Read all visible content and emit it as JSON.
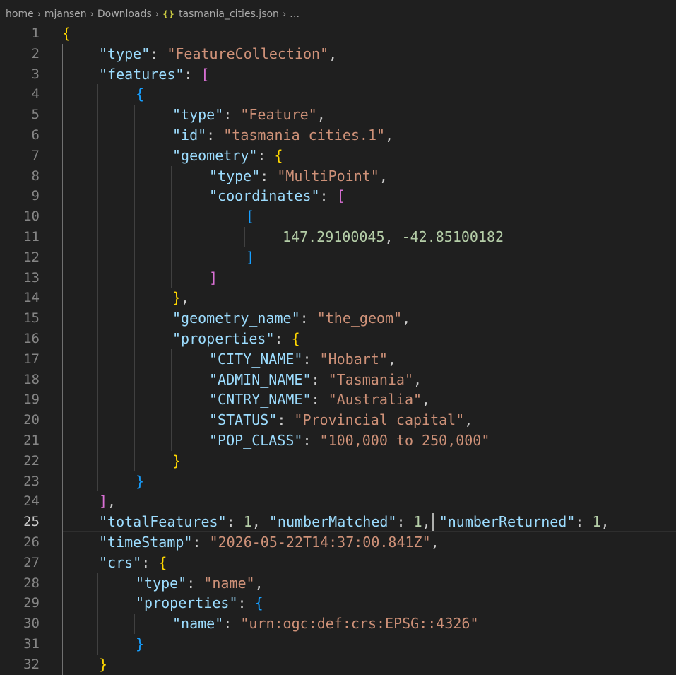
{
  "breadcrumb": {
    "items": [
      "home",
      "mjansen",
      "Downloads"
    ],
    "file_icon": "{}",
    "file": "tasmania_cities.json",
    "more": "…"
  },
  "editor": {
    "current_line": 25,
    "lines": [
      {
        "n": "1",
        "indent": 0,
        "tokens": [
          [
            "b1",
            "{"
          ]
        ]
      },
      {
        "n": "2",
        "indent": 1,
        "tokens": [
          [
            "k",
            "\"type\""
          ],
          [
            "p",
            ": "
          ],
          [
            "s",
            "\"FeatureCollection\""
          ],
          [
            "p",
            ","
          ]
        ]
      },
      {
        "n": "3",
        "indent": 1,
        "tokens": [
          [
            "k",
            "\"features\""
          ],
          [
            "p",
            ": "
          ],
          [
            "b2",
            "["
          ]
        ]
      },
      {
        "n": "4",
        "indent": 2,
        "tokens": [
          [
            "b3",
            "{"
          ]
        ]
      },
      {
        "n": "5",
        "indent": 3,
        "tokens": [
          [
            "k",
            "\"type\""
          ],
          [
            "p",
            ": "
          ],
          [
            "s",
            "\"Feature\""
          ],
          [
            "p",
            ","
          ]
        ]
      },
      {
        "n": "6",
        "indent": 3,
        "tokens": [
          [
            "k",
            "\"id\""
          ],
          [
            "p",
            ": "
          ],
          [
            "s",
            "\"tasmania_cities.1\""
          ],
          [
            "p",
            ","
          ]
        ]
      },
      {
        "n": "7",
        "indent": 3,
        "tokens": [
          [
            "k",
            "\"geometry\""
          ],
          [
            "p",
            ": "
          ],
          [
            "b1",
            "{"
          ]
        ]
      },
      {
        "n": "8",
        "indent": 4,
        "tokens": [
          [
            "k",
            "\"type\""
          ],
          [
            "p",
            ": "
          ],
          [
            "s",
            "\"MultiPoint\""
          ],
          [
            "p",
            ","
          ]
        ]
      },
      {
        "n": "9",
        "indent": 4,
        "tokens": [
          [
            "k",
            "\"coordinates\""
          ],
          [
            "p",
            ": "
          ],
          [
            "b2",
            "["
          ]
        ]
      },
      {
        "n": "10",
        "indent": 5,
        "tokens": [
          [
            "b3",
            "["
          ]
        ]
      },
      {
        "n": "11",
        "indent": 6,
        "tokens": [
          [
            "n",
            "147.29100045"
          ],
          [
            "p",
            ", "
          ],
          [
            "n",
            "-42.85100182"
          ]
        ]
      },
      {
        "n": "12",
        "indent": 5,
        "tokens": [
          [
            "b3",
            "]"
          ]
        ]
      },
      {
        "n": "13",
        "indent": 4,
        "tokens": [
          [
            "b2",
            "]"
          ]
        ]
      },
      {
        "n": "14",
        "indent": 3,
        "tokens": [
          [
            "b1",
            "}"
          ],
          [
            "p",
            ","
          ]
        ]
      },
      {
        "n": "15",
        "indent": 3,
        "tokens": [
          [
            "k",
            "\"geometry_name\""
          ],
          [
            "p",
            ": "
          ],
          [
            "s",
            "\"the_geom\""
          ],
          [
            "p",
            ","
          ]
        ]
      },
      {
        "n": "16",
        "indent": 3,
        "tokens": [
          [
            "k",
            "\"properties\""
          ],
          [
            "p",
            ": "
          ],
          [
            "b1",
            "{"
          ]
        ]
      },
      {
        "n": "17",
        "indent": 4,
        "tokens": [
          [
            "k",
            "\"CITY_NAME\""
          ],
          [
            "p",
            ": "
          ],
          [
            "s",
            "\"Hobart\""
          ],
          [
            "p",
            ","
          ]
        ]
      },
      {
        "n": "18",
        "indent": 4,
        "tokens": [
          [
            "k",
            "\"ADMIN_NAME\""
          ],
          [
            "p",
            ": "
          ],
          [
            "s",
            "\"Tasmania\""
          ],
          [
            "p",
            ","
          ]
        ]
      },
      {
        "n": "19",
        "indent": 4,
        "tokens": [
          [
            "k",
            "\"CNTRY_NAME\""
          ],
          [
            "p",
            ": "
          ],
          [
            "s",
            "\"Australia\""
          ],
          [
            "p",
            ","
          ]
        ]
      },
      {
        "n": "20",
        "indent": 4,
        "tokens": [
          [
            "k",
            "\"STATUS\""
          ],
          [
            "p",
            ": "
          ],
          [
            "s",
            "\"Provincial capital\""
          ],
          [
            "p",
            ","
          ]
        ]
      },
      {
        "n": "21",
        "indent": 4,
        "tokens": [
          [
            "k",
            "\"POP_CLASS\""
          ],
          [
            "p",
            ": "
          ],
          [
            "s",
            "\"100,000 to 250,000\""
          ]
        ]
      },
      {
        "n": "22",
        "indent": 3,
        "tokens": [
          [
            "b1",
            "}"
          ]
        ]
      },
      {
        "n": "23",
        "indent": 2,
        "tokens": [
          [
            "b3",
            "}"
          ]
        ]
      },
      {
        "n": "24",
        "indent": 1,
        "tokens": [
          [
            "b2",
            "]"
          ],
          [
            "p",
            ","
          ]
        ]
      },
      {
        "n": "25",
        "indent": 1,
        "tokens": [
          [
            "k",
            "\"totalFeatures\""
          ],
          [
            "p",
            ": "
          ],
          [
            "n",
            "1"
          ],
          [
            "p",
            ", "
          ],
          [
            "k",
            "\"numberMatched\""
          ],
          [
            "p",
            ": "
          ],
          [
            "n",
            "1"
          ],
          [
            "p",
            ", "
          ],
          [
            "k",
            "\"numberReturned\""
          ],
          [
            "p",
            ": "
          ],
          [
            "n",
            "1"
          ],
          [
            "p",
            ","
          ]
        ]
      },
      {
        "n": "26",
        "indent": 1,
        "tokens": [
          [
            "k",
            "\"timeStamp\""
          ],
          [
            "p",
            ": "
          ],
          [
            "s",
            "\"2026-05-22T14:37:00.841Z\""
          ],
          [
            "p",
            ","
          ]
        ]
      },
      {
        "n": "27",
        "indent": 1,
        "tokens": [
          [
            "k",
            "\"crs\""
          ],
          [
            "p",
            ": "
          ],
          [
            "b1",
            "{"
          ]
        ]
      },
      {
        "n": "28",
        "indent": 2,
        "tokens": [
          [
            "k",
            "\"type\""
          ],
          [
            "p",
            ": "
          ],
          [
            "s",
            "\"name\""
          ],
          [
            "p",
            ","
          ]
        ]
      },
      {
        "n": "29",
        "indent": 2,
        "tokens": [
          [
            "k",
            "\"properties\""
          ],
          [
            "p",
            ": "
          ],
          [
            "b3",
            "{"
          ]
        ]
      },
      {
        "n": "30",
        "indent": 3,
        "tokens": [
          [
            "k",
            "\"name\""
          ],
          [
            "p",
            ": "
          ],
          [
            "s",
            "\"urn:ogc:def:crs:EPSG::4326\""
          ]
        ]
      },
      {
        "n": "31",
        "indent": 2,
        "tokens": [
          [
            "b3",
            "}"
          ]
        ]
      },
      {
        "n": "32",
        "indent": 1,
        "tokens": [
          [
            "b1",
            "}"
          ]
        ]
      }
    ]
  }
}
